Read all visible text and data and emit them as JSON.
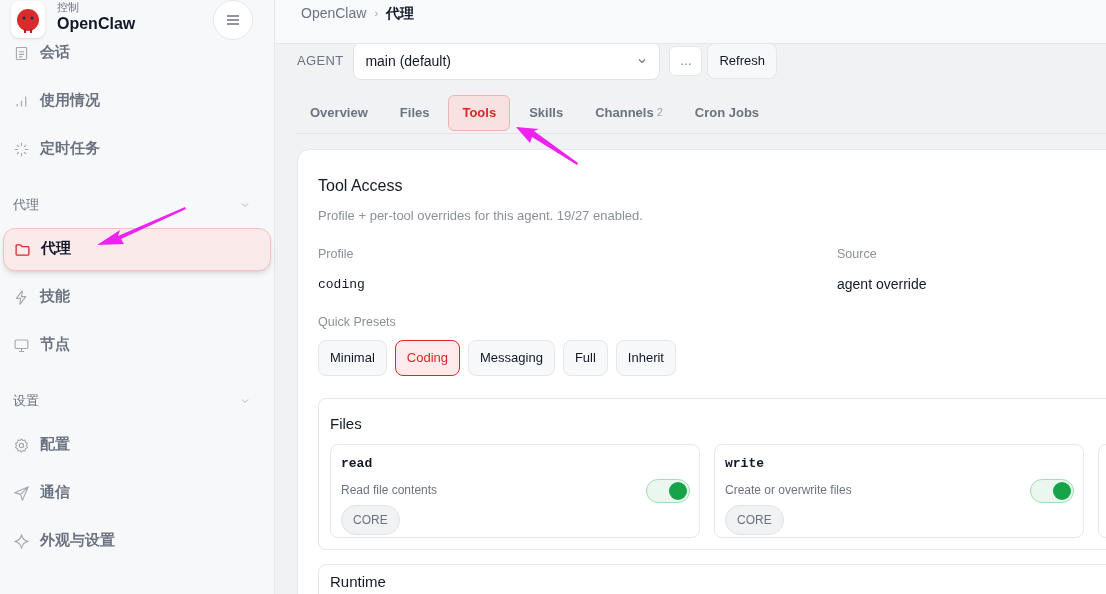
{
  "sidebar": {
    "brand": {
      "subtitle": "控制",
      "title": "OpenClaw"
    },
    "sections": [
      {
        "items": [
          {
            "label": "会话",
            "selected": false
          },
          {
            "label": "使用情况",
            "selected": false
          },
          {
            "label": "定时任务",
            "selected": false
          }
        ]
      },
      {
        "title": "代理",
        "expanded": true,
        "items": [
          {
            "label": "代理",
            "selected": true
          },
          {
            "label": "技能",
            "selected": false
          },
          {
            "label": "节点",
            "selected": false
          }
        ]
      },
      {
        "title": "设置",
        "expanded": true,
        "items": [
          {
            "label": "配置",
            "selected": false
          },
          {
            "label": "通信",
            "selected": false
          },
          {
            "label": "外观与设置",
            "selected": false
          }
        ]
      }
    ]
  },
  "breadcrumb": [
    "OpenClaw",
    "代理"
  ],
  "breadcrumb_separator": "›",
  "agent": {
    "label": "AGENT",
    "value": "main (default)",
    "more": "…",
    "refresh": "Refresh"
  },
  "tabs": [
    {
      "label": "Overview",
      "selected": false
    },
    {
      "label": "Files",
      "selected": false
    },
    {
      "label": "Tools",
      "selected": true
    },
    {
      "label": "Skills",
      "selected": false
    },
    {
      "label": "Channels",
      "count": "2",
      "selected": false
    },
    {
      "label": "Cron Jobs",
      "selected": false
    }
  ],
  "tool_access": {
    "title": "Tool Access",
    "subtitle": "Profile + per-tool overrides for this agent. 19/27 enabled.",
    "profile": {
      "label": "Profile",
      "value": "coding"
    },
    "source": {
      "label": "Source",
      "value": "agent override"
    },
    "presets_label": "Quick Presets",
    "presets": [
      {
        "label": "Minimal",
        "selected": false
      },
      {
        "label": "Coding",
        "selected": true
      },
      {
        "label": "Messaging",
        "selected": false
      },
      {
        "label": "Full",
        "selected": false
      },
      {
        "label": "Inherit",
        "selected": false
      }
    ],
    "groups": [
      {
        "title": "Files",
        "tools": [
          {
            "name": "read",
            "description": "Read file contents",
            "badge": "CORE",
            "on": true
          },
          {
            "name": "write",
            "description": "Create or overwrite files",
            "badge": "CORE",
            "on": true
          }
        ]
      },
      {
        "title": "Runtime"
      }
    ]
  }
}
